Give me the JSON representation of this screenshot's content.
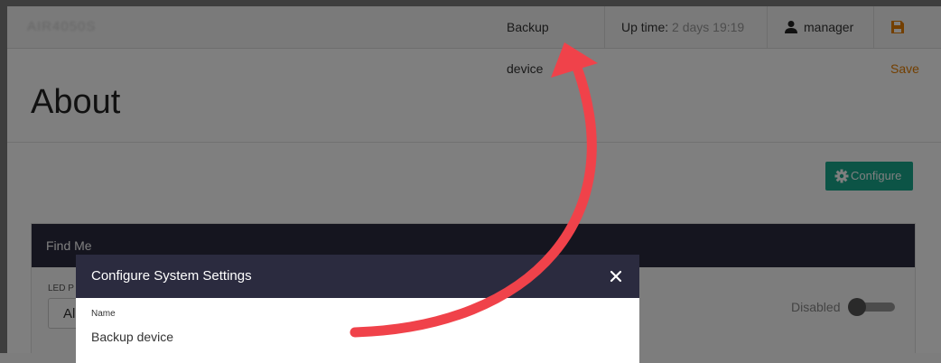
{
  "topbar": {
    "brand": "AIR4050S",
    "device_name": "Backup device",
    "uptime_label": "Up time:",
    "uptime_value": "2 days 19:19",
    "user": "manager",
    "save_label": "Save"
  },
  "page": {
    "title": "About",
    "configure_label": "Configure"
  },
  "find_me": {
    "title": "Find Me",
    "led_label": "LED P",
    "led_value": "All",
    "toggle_label": "Disabled"
  },
  "modal": {
    "title": "Configure System Settings",
    "name_label": "Name",
    "name_value": "Backup device"
  },
  "colors": {
    "accent": "#19a88c",
    "header_dark": "#2b2b3f",
    "save": "#e67e00",
    "arrow": "#f0424a"
  },
  "icons": [
    "user-icon",
    "save-icon",
    "gear-icon",
    "close-icon"
  ]
}
